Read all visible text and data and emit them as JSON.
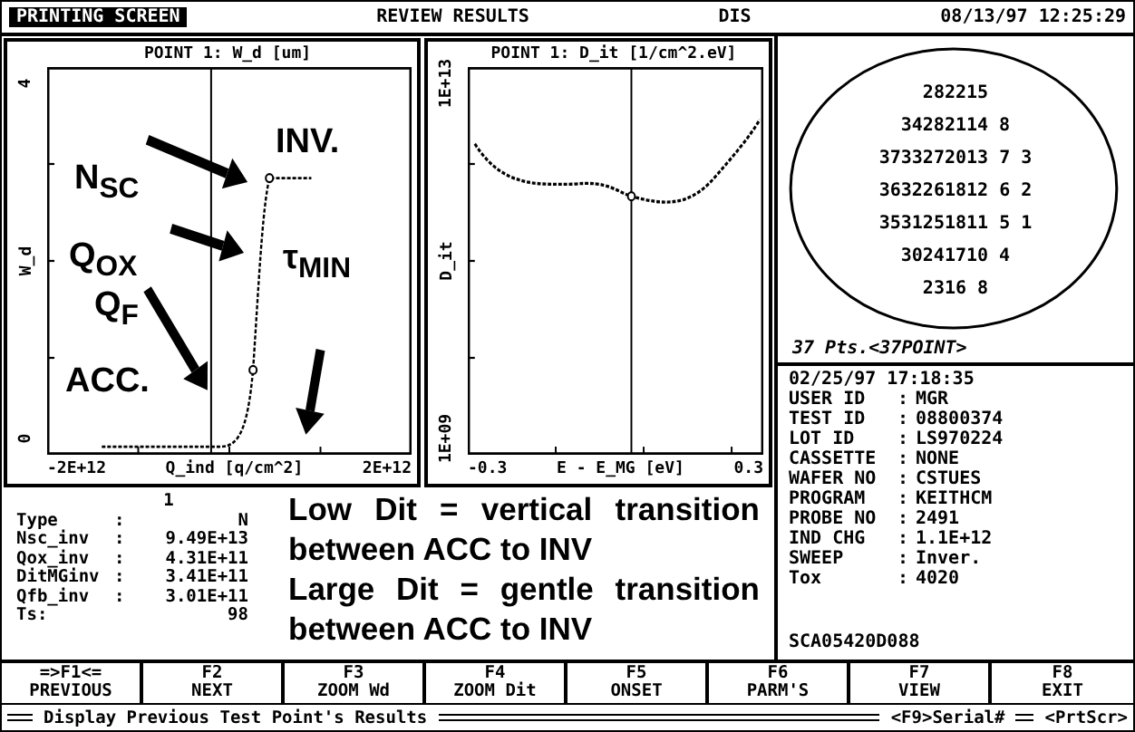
{
  "top_bar": {
    "mode": "PRINTING SCREEN",
    "title": "REVIEW RESULTS",
    "code": "DIS",
    "datetime": "08/13/97 12:25:29"
  },
  "wd_chart": {
    "title": "POINT 1: W_d [um]",
    "ylabel": "W_d",
    "ytop": "4",
    "ybottom": "0",
    "xleft": "-2E+12",
    "xlabel": "Q_ind [q/cm^2]",
    "xright": "2E+12",
    "annotations": [
      {
        "label": "INV."
      },
      {
        "label": "N$_{SC}$"
      },
      {
        "label": "Q$_{OX}$"
      },
      {
        "label": "τ$_{MIN}$"
      },
      {
        "label": "Q$_{F}$"
      },
      {
        "label": "ACC."
      }
    ]
  },
  "dit_chart": {
    "title": "POINT 1: D_it [1/cm^2.eV]",
    "ylabel": "D_it",
    "ytop": "1E+13",
    "ybottom": "1E+09",
    "xleft": "-0.3",
    "xlabel": "E - E_MG [eV]",
    "xright": "0.3"
  },
  "wafer_map": {
    "rows": [
      "282215",
      "34282114 8",
      "3733272013 7 3",
      "3632261812 6 2",
      "3531251811 5 1",
      "30241710 4",
      "2316 8"
    ],
    "footer": "37 Pts.<37POINT>"
  },
  "params": {
    "header": "1",
    "rows": [
      {
        "label": "Type",
        "sep": ":",
        "value": "N"
      },
      {
        "label": "Nsc_inv",
        "sep": ":",
        "value": "9.49E+13"
      },
      {
        "label": "Qox_inv",
        "sep": ":",
        "value": "4.31E+11"
      },
      {
        "label": "DitMGinv",
        "sep": ":",
        "value": "3.41E+11"
      },
      {
        "label": "Qfb_inv",
        "sep": ":",
        "value": "3.01E+11"
      },
      {
        "label": "Ts:",
        "value": "98"
      }
    ]
  },
  "notes": [
    "Low Dit = vertical transition between ACC to INV",
    "Large Dit = gentle transition between ACC to INV"
  ],
  "info": {
    "timestamp": "02/25/97 17:18:35",
    "rows": [
      {
        "label": "USER ID",
        "sep": ":",
        "value": "MGR"
      },
      {
        "label": "TEST ID",
        "sep": ":",
        "value": "08800374"
      },
      {
        "label": "LOT ID",
        "sep": ":",
        "value": "LS970224"
      },
      {
        "label": "CASSETTE",
        "sep": ":",
        "value": "NONE"
      },
      {
        "label": "WAFER NO",
        "sep": ":",
        "value": "CSTUES"
      },
      {
        "label": "PROGRAM",
        "sep": ":",
        "value": "KEITHCM"
      },
      {
        "label": "PROBE NO",
        "sep": ":",
        "value": "2491"
      },
      {
        "label": "IND CHG",
        "sep": ":",
        "value": "1.1E+12"
      },
      {
        "label": "SWEEP",
        "sep": ":",
        "value": "Inver."
      },
      {
        "label": "Tox",
        "sep": ":",
        "value": "4020"
      }
    ],
    "serial": "SCA05420D088"
  },
  "function_keys": [
    {
      "key": "=>F1<=",
      "label": "PREVIOUS"
    },
    {
      "key": "F2",
      "label": "NEXT"
    },
    {
      "key": "F3",
      "label": "ZOOM Wd"
    },
    {
      "key": "F4",
      "label": "ZOOM Dit"
    },
    {
      "key": "F5",
      "label": "ONSET"
    },
    {
      "key": "F6",
      "label": "PARM'S"
    },
    {
      "key": "F7",
      "label": "VIEW"
    },
    {
      "key": "F8",
      "label": "EXIT"
    }
  ],
  "status_bar": {
    "message": "Display Previous Test Point's Results",
    "serial_hint": "<F9>Serial#",
    "print_hint": "<PrtScr>"
  }
}
